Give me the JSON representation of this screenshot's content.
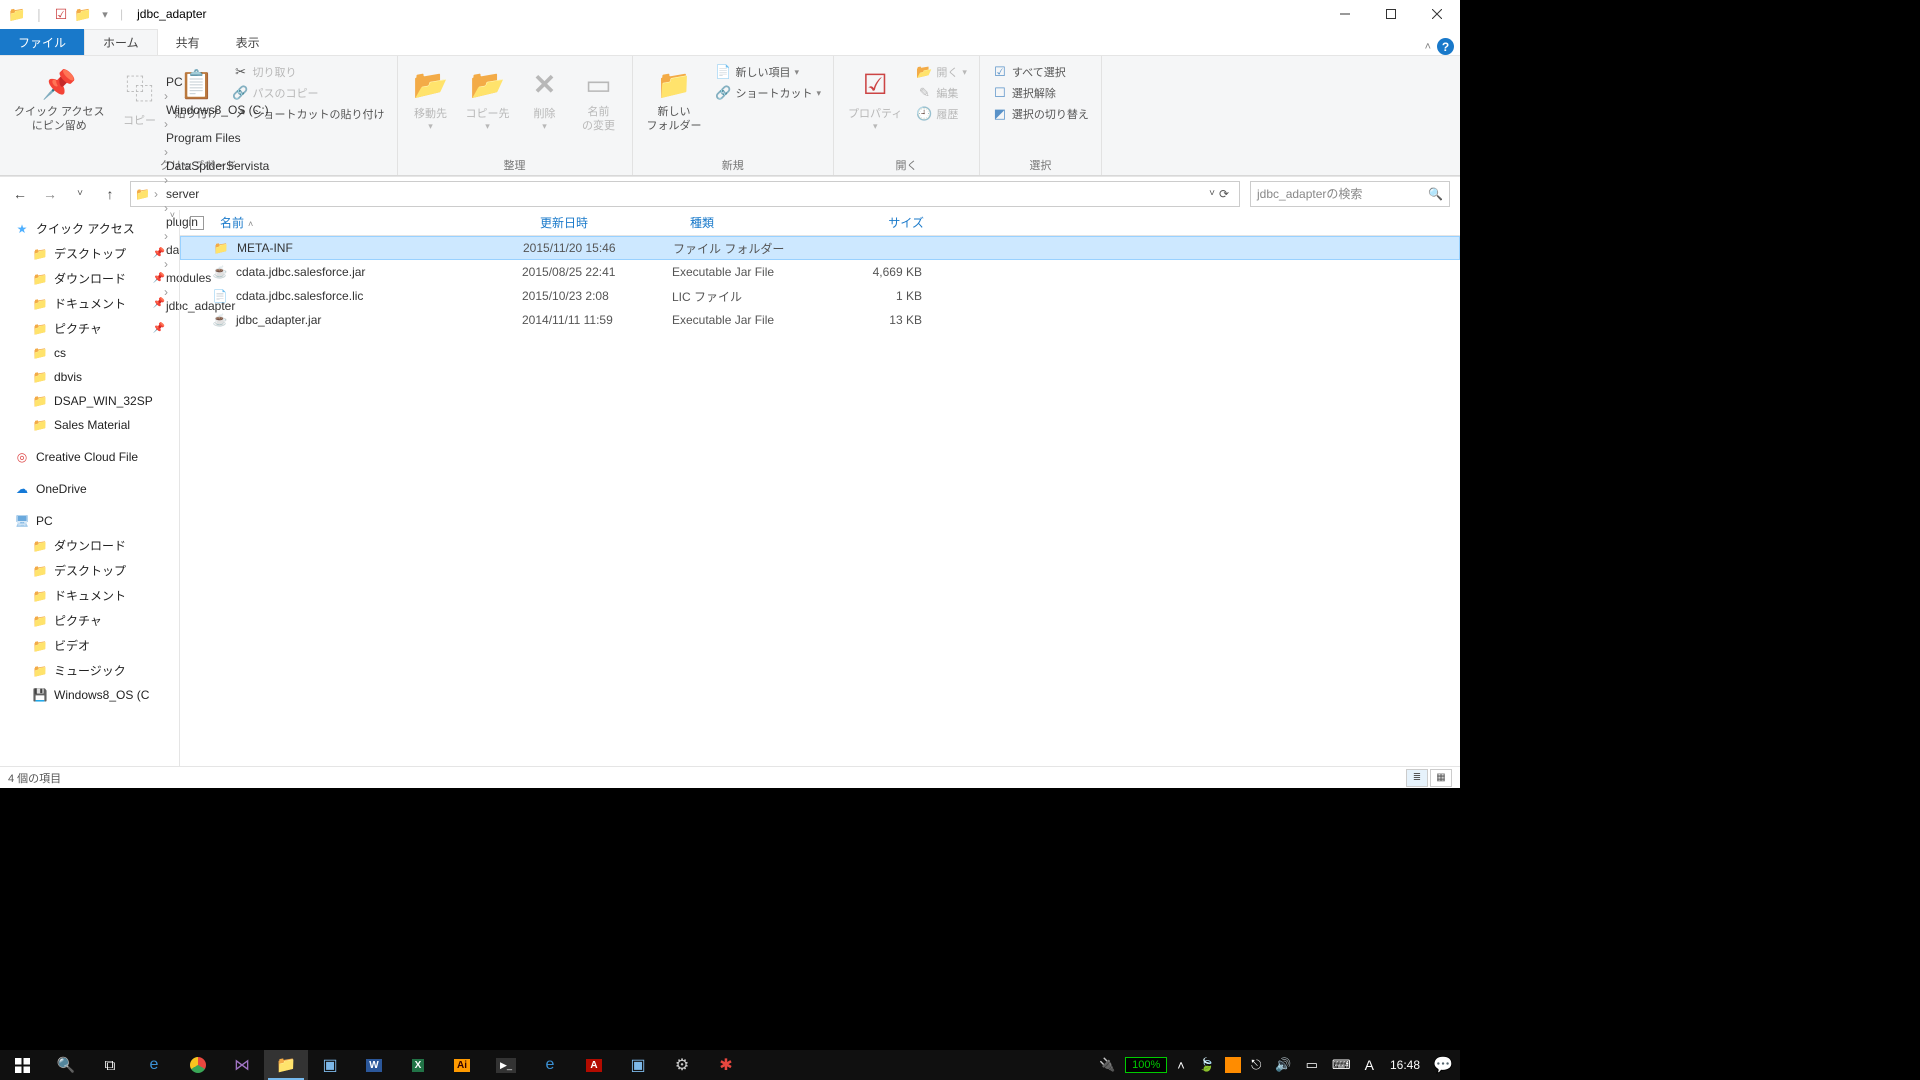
{
  "window": {
    "title": "jdbc_adapter"
  },
  "tabs": {
    "file": "ファイル",
    "home": "ホーム",
    "share": "共有",
    "view": "表示"
  },
  "ribbon": {
    "clipboard": {
      "pin": "クイック アクセス\nにピン留め",
      "copy": "コピー",
      "paste": "貼り付け",
      "copy_path": "パスのコピー",
      "paste_shortcut": "ショートカットの貼り付け",
      "cut": "切り取り",
      "label": "クリップボード"
    },
    "organize": {
      "moveto": "移動先",
      "copyto": "コピー先",
      "delete": "削除",
      "rename": "名前\nの変更",
      "label": "整理"
    },
    "new": {
      "newfolder": "新しい\nフォルダー",
      "newitem": "新しい項目",
      "shortcut": "ショートカット",
      "label": "新規"
    },
    "open": {
      "properties": "プロパティ",
      "open": "開く",
      "edit": "編集",
      "history": "履歴",
      "label": "開く"
    },
    "select": {
      "all": "すべて選択",
      "none": "選択解除",
      "invert": "選択の切り替え",
      "label": "選択"
    }
  },
  "breadcrumbs": [
    "PC",
    "Windows8_OS (C:)",
    "Program Files",
    "DataSpiderServista",
    "server",
    "plugin",
    "data_processing",
    "modules",
    "jdbc_adapter"
  ],
  "search_placeholder": "jdbc_adapterの検索",
  "columns": {
    "name": "名前",
    "date": "更新日時",
    "type": "種類",
    "size": "サイズ"
  },
  "files": [
    {
      "icon": "folder",
      "name": "META-INF",
      "date": "2015/11/20 15:46",
      "type": "ファイル フォルダー",
      "size": "",
      "selected": true
    },
    {
      "icon": "jar",
      "name": "cdata.jdbc.salesforce.jar",
      "date": "2015/08/25 22:41",
      "type": "Executable Jar File",
      "size": "4,669 KB"
    },
    {
      "icon": "lic",
      "name": "cdata.jdbc.salesforce.lic",
      "date": "2015/10/23 2:08",
      "type": "LIC ファイル",
      "size": "1 KB"
    },
    {
      "icon": "jar",
      "name": "jdbc_adapter.jar",
      "date": "2014/11/11 11:59",
      "type": "Executable Jar File",
      "size": "13 KB"
    }
  ],
  "sidebar": {
    "quick_access": "クイック アクセス",
    "desktop": "デスクトップ",
    "downloads": "ダウンロード",
    "documents": "ドキュメント",
    "pictures": "ピクチャ",
    "cs": "cs",
    "dbvis": "dbvis",
    "dsap": "DSAP_WIN_32SP",
    "sales": "Sales Material",
    "ccloud": "Creative Cloud File",
    "onedrive": "OneDrive",
    "pc": "PC",
    "pc_downloads": "ダウンロード",
    "pc_desktop": "デスクトップ",
    "pc_documents": "ドキュメント",
    "pc_pictures": "ピクチャ",
    "pc_videos": "ビデオ",
    "pc_music": "ミュージック",
    "pc_osdisc": "Windows8_OS (C"
  },
  "status": "4 個の項目",
  "taskbar": {
    "battery": "100%",
    "clock": "16:48",
    "ime": "A"
  }
}
